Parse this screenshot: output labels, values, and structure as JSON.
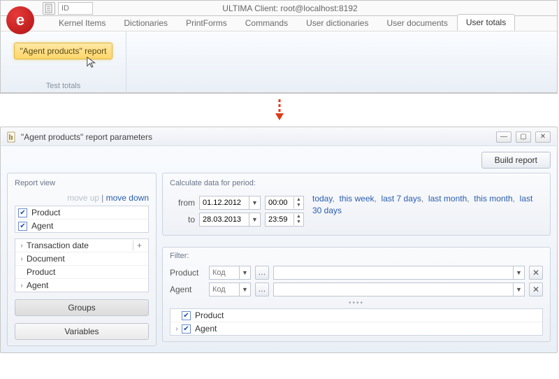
{
  "window1": {
    "title": "ULTIMA Client: root@localhost:8192",
    "id_placeholder": "ID",
    "logo_letter": "e",
    "tabs": [
      "Kernel Items",
      "Dictionaries",
      "PrintForms",
      "Commands",
      "User dictionaries",
      "User documents",
      "User totals"
    ],
    "active_tab": 6,
    "ribbon_button": "\"Agent products\" report",
    "ribbon_group": "Test totals"
  },
  "window2": {
    "title": "\"Agent products\" report parameters",
    "build_button": "Build report",
    "left": {
      "title": "Report view",
      "move_up": "move up",
      "move_down": "move down",
      "checked": [
        "Product",
        "Agent"
      ],
      "fields": [
        "Transaction date",
        "Document",
        "Product",
        "Agent"
      ],
      "groups_btn": "Groups",
      "vars_btn": "Variables"
    },
    "period": {
      "title": "Calculate data for period:",
      "from_label": "from",
      "to_label": "to",
      "from_date": "01.12.2012",
      "from_time": "00:00",
      "to_date": "28.03.2013",
      "to_time": "23:59",
      "quick": [
        "today",
        "this week",
        "last 7 days",
        "last month",
        "this month",
        "last 30 days"
      ]
    },
    "filter": {
      "title": "Filter:",
      "rows": [
        {
          "label": "Product",
          "placeholder": "Код"
        },
        {
          "label": "Agent",
          "placeholder": "Код"
        }
      ],
      "list": [
        "Product",
        "Agent"
      ]
    }
  }
}
